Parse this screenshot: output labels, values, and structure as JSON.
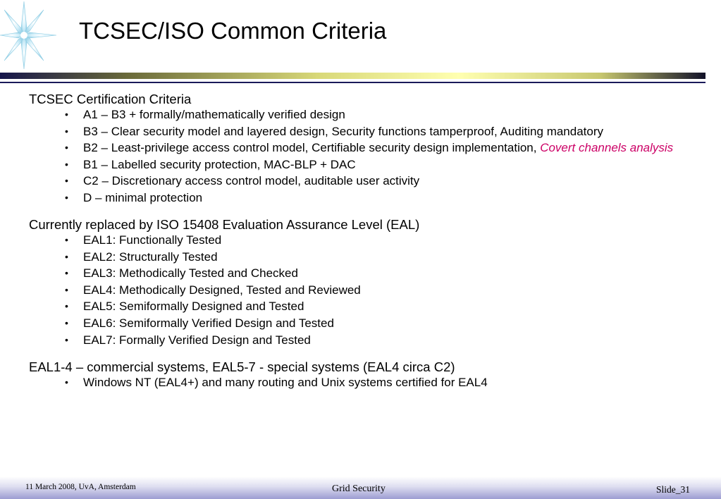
{
  "slide": {
    "title": "TCSEC/ISO Common Criteria"
  },
  "sections": [
    {
      "heading": "TCSEC Certification Criteria",
      "items": [
        {
          "text": "A1 – B3 + formally/mathematically verified design"
        },
        {
          "text": "B3 – Clear security model and layered design, Security functions tamperproof, Auditing mandatory"
        },
        {
          "text": "B2 – Least-privilege access control model, Certifiable security design implementation, ",
          "emphasis": "Covert channels analysis"
        },
        {
          "text": "B1 – Labelled security protection, MAC-BLP + DAC"
        },
        {
          "text": "C2 – Discretionary access control model, auditable user activity"
        },
        {
          "text": "D – minimal protection"
        }
      ]
    },
    {
      "heading": "Currently replaced by ISO 15408 Evaluation Assurance Level (EAL)",
      "items": [
        {
          "text": "EAL1: Functionally Tested"
        },
        {
          "text": "EAL2: Structurally Tested"
        },
        {
          "text": "EAL3: Methodically Tested and Checked"
        },
        {
          "text": "EAL4: Methodically Designed, Tested and Reviewed"
        },
        {
          "text": "EAL5: Semiformally Designed and Tested"
        },
        {
          "text": "EAL6: Semiformally Verified Design and Tested"
        },
        {
          "text": "EAL7: Formally Verified Design and Tested"
        }
      ]
    },
    {
      "heading": "EAL1-4 – commercial systems, EAL5-7 - special systems (EAL4 circa C2)",
      "items": [
        {
          "text": "Windows NT (EAL4+) and many routing and Unix systems certified for EAL4"
        }
      ]
    }
  ],
  "footer": {
    "left": "11 March 2008, UvA, Amsterdam",
    "center": "Grid Security",
    "right": "Slide_31"
  },
  "colors": {
    "emphasis": "#cc0066",
    "rule": "#1a1a5a",
    "star": "#9fd6ea"
  },
  "icons": {
    "logo": "star-burst-icon",
    "bullet": "bullet-dot-icon"
  }
}
